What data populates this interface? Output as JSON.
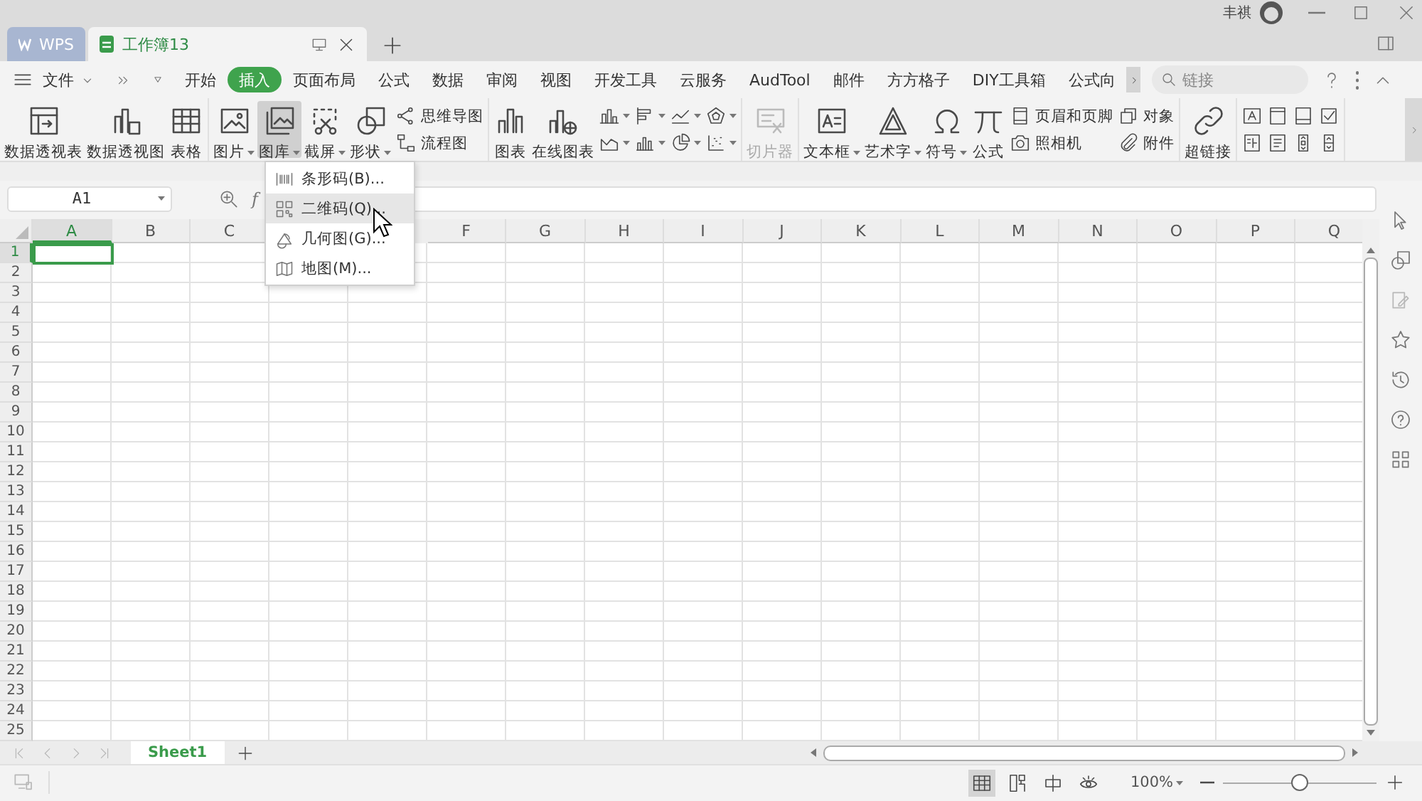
{
  "title_bar": {
    "tabs": [
      {
        "kind": "home",
        "label": "WPS",
        "selected": false
      },
      {
        "kind": "document",
        "label": "工作簿13",
        "selected": true
      }
    ],
    "user_name": "丰祺"
  },
  "menu_bar": {
    "file_label": "文件",
    "tabs": [
      {
        "label": "开始",
        "selected": false
      },
      {
        "label": "插入",
        "selected": true
      },
      {
        "label": "页面布局",
        "selected": false
      },
      {
        "label": "公式",
        "selected": false
      },
      {
        "label": "数据",
        "selected": false
      },
      {
        "label": "审阅",
        "selected": false
      },
      {
        "label": "视图",
        "selected": false
      },
      {
        "label": "开发工具",
        "selected": false
      },
      {
        "label": "云服务",
        "selected": false
      },
      {
        "label": "AudTool",
        "selected": false
      },
      {
        "label": "邮件",
        "selected": false
      },
      {
        "label": "方方格子",
        "selected": false
      },
      {
        "label": "DIY工具箱",
        "selected": false
      },
      {
        "label": "公式向",
        "selected": false
      }
    ],
    "search": {
      "placeholder": "链接"
    }
  },
  "ribbon": {
    "groups": [
      {
        "items": [
          {
            "kind": "large",
            "label": "数据透视表",
            "dropdown": false,
            "pressed": false,
            "disabled": false
          },
          {
            "kind": "large",
            "label": "数据透视图",
            "dropdown": false,
            "pressed": false,
            "disabled": false
          },
          {
            "kind": "large",
            "label": "表格",
            "dropdown": false,
            "pressed": false,
            "disabled": false
          }
        ]
      },
      {
        "items": [
          {
            "kind": "large",
            "label": "图片",
            "dropdown": true,
            "pressed": false,
            "disabled": false
          },
          {
            "kind": "large",
            "label": "图库",
            "dropdown": true,
            "pressed": true,
            "disabled": false
          },
          {
            "kind": "large",
            "label": "截屏",
            "dropdown": true,
            "pressed": false,
            "disabled": false
          },
          {
            "kind": "large",
            "label": "形状",
            "dropdown": true,
            "pressed": false,
            "disabled": false
          },
          {
            "kind": "stack",
            "items": [
              {
                "kind": "small",
                "label": "思维导图"
              },
              {
                "kind": "small",
                "label": "流程图"
              }
            ]
          }
        ]
      },
      {
        "items": [
          {
            "kind": "large",
            "label": "图表",
            "dropdown": false,
            "pressed": false,
            "disabled": false
          },
          {
            "kind": "large",
            "label": "在线图表",
            "dropdown": false,
            "pressed": false,
            "disabled": false
          },
          {
            "kind": "stack",
            "items": [
              {
                "kind": "icon",
                "dropdown": true
              },
              {
                "kind": "icon",
                "dropdown": true
              },
              {
                "kind": "icon",
                "dropdown": true
              },
              {
                "kind": "icon",
                "dropdown": true
              },
              {
                "kind": "icon",
                "dropdown": true
              },
              {
                "kind": "icon",
                "dropdown": true
              },
              {
                "kind": "icon",
                "dropdown": true
              },
              {
                "kind": "icon",
                "dropdown": true
              }
            ]
          }
        ]
      },
      {
        "items": [
          {
            "kind": "large",
            "label": "切片器",
            "dropdown": false,
            "pressed": false,
            "disabled": true
          }
        ]
      },
      {
        "items": [
          {
            "kind": "large",
            "label": "文本框",
            "dropdown": true,
            "pressed": false,
            "disabled": false
          },
          {
            "kind": "large",
            "label": "艺术字",
            "dropdown": true,
            "pressed": false,
            "disabled": false
          },
          {
            "kind": "large",
            "label": "符号",
            "dropdown": true,
            "pressed": false,
            "disabled": false
          },
          {
            "kind": "large",
            "label": "公式",
            "dropdown": false,
            "pressed": false,
            "disabled": false
          },
          {
            "kind": "stack",
            "items": [
              {
                "kind": "small",
                "label": "页眉和页脚"
              },
              {
                "kind": "small",
                "label": "照相机"
              }
            ]
          },
          {
            "kind": "stack",
            "items": [
              {
                "kind": "small",
                "label": "对象"
              },
              {
                "kind": "small",
                "label": "附件"
              }
            ]
          }
        ]
      },
      {
        "items": [
          {
            "kind": "large",
            "label": "超链接",
            "dropdown": false,
            "pressed": false,
            "disabled": false
          }
        ]
      },
      {
        "items": [
          {
            "kind": "stack",
            "items": [
              {
                "kind": "icon"
              },
              {
                "kind": "icon"
              },
              {
                "kind": "icon"
              },
              {
                "kind": "icon"
              },
              {
                "kind": "icon"
              },
              {
                "kind": "icon"
              },
              {
                "kind": "icon"
              },
              {
                "kind": "icon"
              }
            ]
          }
        ]
      }
    ]
  },
  "gallery_menu": {
    "items": [
      {
        "label": "条形码(B)...",
        "selected": false
      },
      {
        "label": "二维码(Q)...",
        "selected": true
      },
      {
        "label": "几何图(G)...",
        "selected": false
      },
      {
        "label": "地图(M)...",
        "selected": false
      }
    ]
  },
  "formula_bar": {
    "name_box": "A1",
    "function_label": "f"
  },
  "sheet": {
    "columns_left": [
      {
        "label": "A",
        "selected": true
      },
      {
        "label": "B",
        "selected": false
      },
      {
        "label": "C",
        "selected": false
      }
    ],
    "columns_right": [
      {
        "label": "F",
        "selected": false
      },
      {
        "label": "G",
        "selected": false
      },
      {
        "label": "H",
        "selected": false
      },
      {
        "label": "I",
        "selected": false
      },
      {
        "label": "J",
        "selected": false
      },
      {
        "label": "K",
        "selected": false
      },
      {
        "label": "L",
        "selected": false
      },
      {
        "label": "M",
        "selected": false
      },
      {
        "label": "N",
        "selected": false
      },
      {
        "label": "O",
        "selected": false
      },
      {
        "label": "P",
        "selected": false
      },
      {
        "label": "Q",
        "selected": false
      }
    ],
    "rows": [
      {
        "label": "1",
        "selected": true
      },
      {
        "label": "2",
        "selected": false
      },
      {
        "label": "3",
        "selected": false
      },
      {
        "label": "4",
        "selected": false
      },
      {
        "label": "5",
        "selected": false
      },
      {
        "label": "6",
        "selected": false
      },
      {
        "label": "7",
        "selected": false
      },
      {
        "label": "8",
        "selected": false
      },
      {
        "label": "9",
        "selected": false
      },
      {
        "label": "10",
        "selected": false
      },
      {
        "label": "11",
        "selected": false
      },
      {
        "label": "12",
        "selected": false
      },
      {
        "label": "13",
        "selected": false
      },
      {
        "label": "14",
        "selected": false
      },
      {
        "label": "15",
        "selected": false
      },
      {
        "label": "16",
        "selected": false
      },
      {
        "label": "17",
        "selected": false
      },
      {
        "label": "18",
        "selected": false
      },
      {
        "label": "19",
        "selected": false
      },
      {
        "label": "20",
        "selected": false
      },
      {
        "label": "21",
        "selected": false
      },
      {
        "label": "22",
        "selected": false
      },
      {
        "label": "23",
        "selected": false
      },
      {
        "label": "24",
        "selected": false
      },
      {
        "label": "25",
        "selected": false
      }
    ]
  },
  "sheet_tabs": [
    {
      "label": "Sheet1",
      "selected": true
    }
  ],
  "status_bar": {
    "views": [
      {
        "selected": true
      },
      {
        "selected": false
      },
      {
        "selected": false
      },
      {
        "selected": false
      }
    ],
    "zoom": "100%",
    "zoom_slider": {
      "level": 0.5
    }
  }
}
